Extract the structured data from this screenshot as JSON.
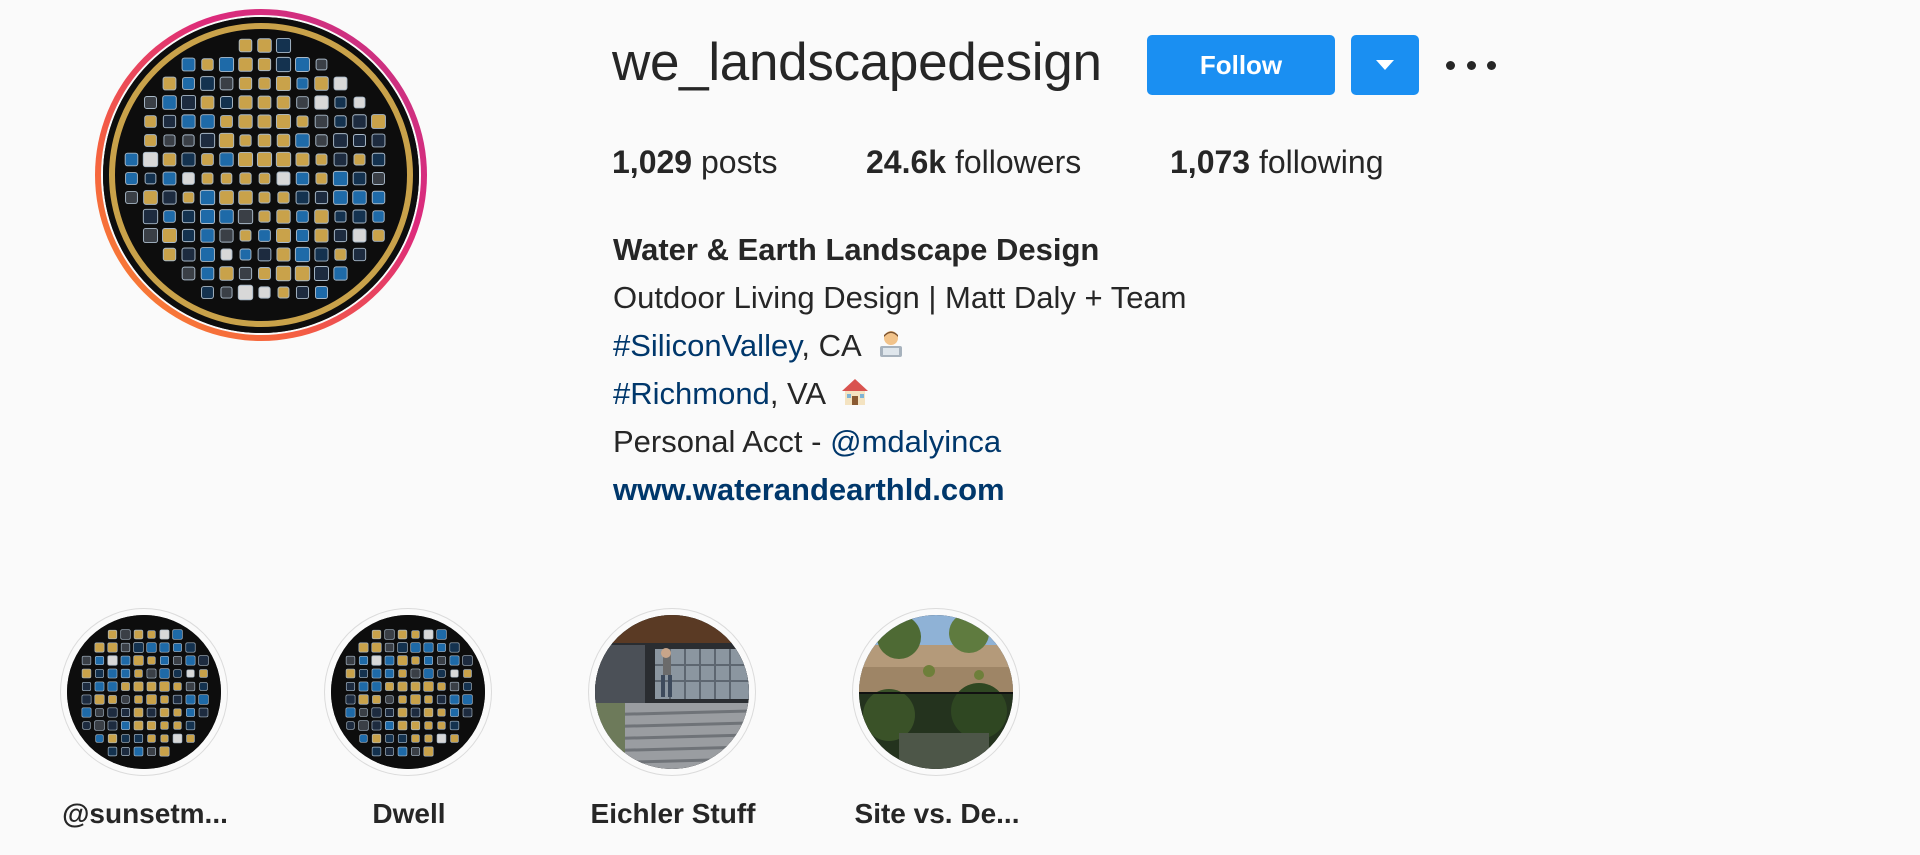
{
  "profile": {
    "username": "we_landscapedesign",
    "avatar_icon": "mosaic-tile-logo-icon"
  },
  "actions": {
    "follow_label": "Follow",
    "dropdown_icon": "chevron-down-icon",
    "more_icon": "more-options-icon"
  },
  "stats": {
    "posts_count": "1,029",
    "posts_label": "posts",
    "followers_count": "24.6k",
    "followers_label": "followers",
    "following_count": "1,073",
    "following_label": "following"
  },
  "bio": {
    "name": "Water & Earth Landscape Design",
    "line1": "Outdoor Living Design | Matt Daly + Team",
    "line2_tag": "#SiliconValley",
    "line2_rest": ", CA",
    "line2_emoji": "technologist-emoji",
    "line3_tag": "#Richmond",
    "line3_rest": ", VA",
    "line3_emoji": "house-emoji",
    "line4_text": "Personal Acct - ",
    "line4_mention": "@mdalyinca",
    "website": "www.waterandearthld.com"
  },
  "highlights": [
    {
      "label": "@sunsetm...",
      "thumb": "mosaic-tile-logo"
    },
    {
      "label": "Dwell",
      "thumb": "mosaic-tile-logo"
    },
    {
      "label": "Eichler Stuff",
      "thumb": "eichler-house-photo"
    },
    {
      "label": "Site vs. De...",
      "thumb": "site-vs-design-photo"
    }
  ],
  "colors": {
    "accent": "#1a8ff2",
    "link": "#00376b",
    "text": "#262626",
    "background": "#fafafa",
    "mosaic_blue": "#1e6aa8",
    "mosaic_gold": "#c9a24a"
  }
}
